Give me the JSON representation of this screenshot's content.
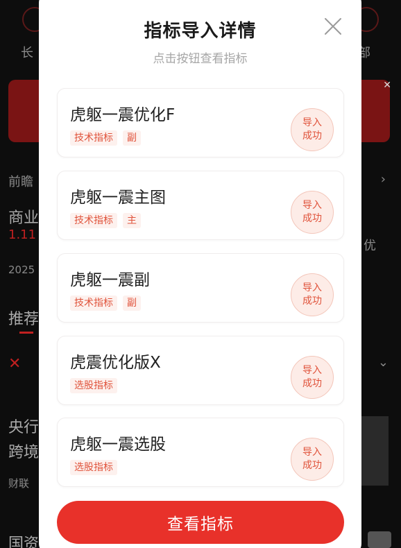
{
  "background": {
    "tabs": [
      "长",
      "部"
    ],
    "rows": [
      "前瞻",
      "商业",
      "1.11",
      "2025",
      "推荐",
      "央行",
      "跨境",
      "财联",
      "国资"
    ],
    "right_texts": [
      "优"
    ]
  },
  "modal": {
    "title": "指标导入详情",
    "subtitle": "点击按钮查看指标",
    "items": [
      {
        "name": "虎躯一震优化F",
        "tags": [
          "技术指标",
          "副"
        ],
        "status": "导入成功"
      },
      {
        "name": "虎躯一震主图",
        "tags": [
          "技术指标",
          "主"
        ],
        "status": "导入成功"
      },
      {
        "name": "虎躯一震副",
        "tags": [
          "技术指标",
          "副"
        ],
        "status": "导入成功"
      },
      {
        "name": "虎震优化版X",
        "tags": [
          "选股指标"
        ],
        "status": "导入成功"
      },
      {
        "name": "虎躯一震选股",
        "tags": [
          "选股指标"
        ],
        "status": "导入成功"
      }
    ],
    "button_label": "查看指标"
  },
  "colors": {
    "accent": "#e8312a",
    "tag_text": "#e0533b",
    "tag_bg": "#fdf1ee"
  },
  "icons": {
    "close": "close-icon"
  }
}
